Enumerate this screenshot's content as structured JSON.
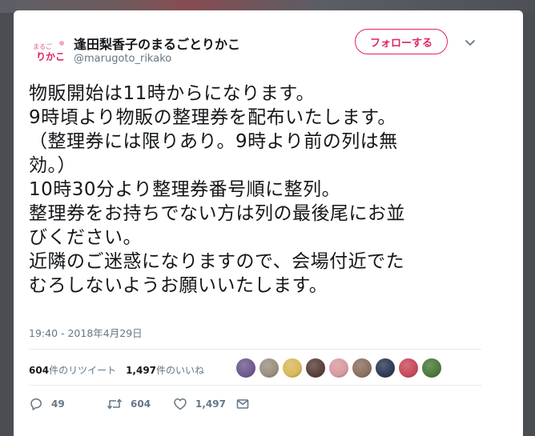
{
  "tweet": {
    "display_name": "逢田梨香子のまるごとりかこ",
    "handle": "@marugoto_rikako",
    "follow_label": "フォローする",
    "text": "物販開始は11時からになります。\n9時頃より物販の整理券を配布いたします。\n（整理券には限りあり。9時より前の列は無\n効。）\n10時30分より整理券番号順に整列。\n整理券をお持ちでない方は列の最後尾にお並\nびください。\n近隣のご迷惑になりますので、会場付近でた\nむろしないようお願いいたします。",
    "timestamp": "19:40 - 2018年4月29日",
    "avatar_text": "まるごとりかこ"
  },
  "stats": {
    "retweet_count": "604",
    "retweet_label": "件のリツイート",
    "like_count": "1,497",
    "like_label": "件のいいね"
  },
  "liker_avatars": [
    "#6e5a8f",
    "#9a9080",
    "#d8b85a",
    "#5a3f3a",
    "#d79aa0",
    "#8a7060",
    "#2d3a55",
    "#c84a5a",
    "#4a7a3a"
  ],
  "actions": {
    "reply_count": "49",
    "retweet_count": "604",
    "like_count": "1,497"
  },
  "colors": {
    "follow_accent": "#e0245e",
    "secondary_text": "#657786",
    "primary_text": "#14171a"
  },
  "icons": {
    "reply": "reply-icon",
    "retweet": "retweet-icon",
    "like": "heart-icon",
    "dm": "envelope-icon",
    "more": "chevron-down-icon"
  }
}
